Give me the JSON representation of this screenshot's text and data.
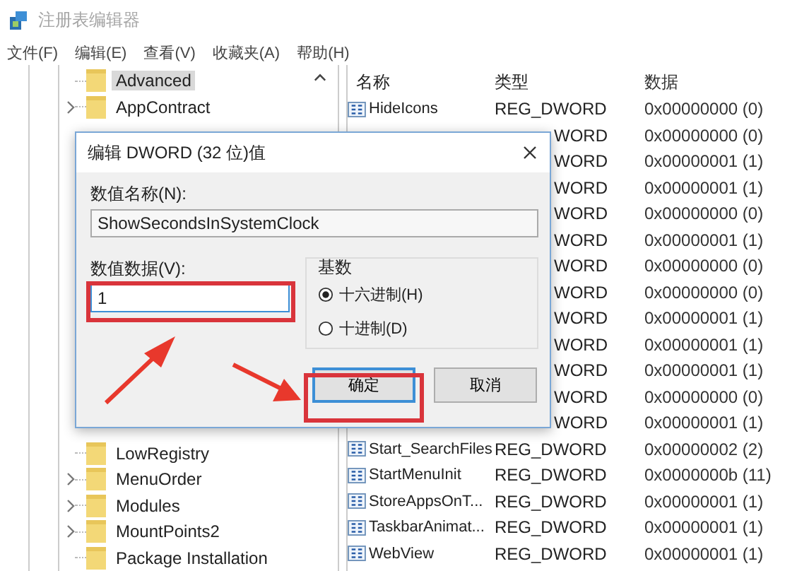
{
  "window": {
    "title": "注册表编辑器"
  },
  "menu": [
    "文件(F)",
    "编辑(E)",
    "查看(V)",
    "收藏夹(A)",
    "帮助(H)"
  ],
  "tree": {
    "top": [
      {
        "label": "Advanced",
        "selected": true,
        "expandable": false
      },
      {
        "label": "AppContract",
        "selected": false,
        "expandable": true
      }
    ],
    "bottom": [
      {
        "label": "LowRegistry",
        "selected": false,
        "expandable": false
      },
      {
        "label": "MenuOrder",
        "selected": false,
        "expandable": true
      },
      {
        "label": "Modules",
        "selected": false,
        "expandable": true
      },
      {
        "label": "MountPoints2",
        "selected": false,
        "expandable": true
      },
      {
        "label": "Package Installation",
        "selected": false,
        "expandable": false
      }
    ]
  },
  "values": {
    "columns": [
      "名称",
      "类型",
      "数据"
    ],
    "rows": [
      {
        "name": "HideIcons",
        "type": "REG_DWORD",
        "data": "0x00000000 (0)"
      },
      {
        "type": "WORD",
        "data": "0x00000000 (0)"
      },
      {
        "type": "WORD",
        "data": "0x00000001 (1)"
      },
      {
        "type": "WORD",
        "data": "0x00000001 (1)"
      },
      {
        "type": "WORD",
        "data": "0x00000000 (0)"
      },
      {
        "type": "WORD",
        "data": "0x00000001 (1)"
      },
      {
        "type": "WORD",
        "data": "0x00000000 (0)"
      },
      {
        "type": "WORD",
        "data": "0x00000000 (0)"
      },
      {
        "type": "WORD",
        "data": "0x00000001 (1)"
      },
      {
        "type": "WORD",
        "data": "0x00000001 (1)"
      },
      {
        "type": "WORD",
        "data": "0x00000001 (1)"
      },
      {
        "type": "WORD",
        "data": "0x00000000 (0)"
      },
      {
        "type": "WORD",
        "data": "0x00000001 (1)"
      },
      {
        "name": "Start_SearchFiles",
        "type": "REG_DWORD",
        "data": "0x00000002 (2)"
      },
      {
        "name": "StartMenuInit",
        "type": "REG_DWORD",
        "data": "0x0000000b (11)"
      },
      {
        "name": "StoreAppsOnT...",
        "type": "REG_DWORD",
        "data": "0x00000001 (1)"
      },
      {
        "name": "TaskbarAnimat...",
        "type": "REG_DWORD",
        "data": "0x00000001 (1)"
      },
      {
        "name": "WebView",
        "type": "REG_DWORD",
        "data": "0x00000001 (1)"
      }
    ]
  },
  "dialog": {
    "title": "编辑 DWORD (32 位)值",
    "name_label": "数值名称(N):",
    "name_value": "ShowSecondsInSystemClock",
    "data_label": "数值数据(V):",
    "data_value": "1",
    "base_label": "基数",
    "radios": [
      {
        "label": "十六进制(H)",
        "selected": true
      },
      {
        "label": "十进制(D)",
        "selected": false
      }
    ],
    "buttons": [
      {
        "label": "确定",
        "default": true
      },
      {
        "label": "取消",
        "default": false
      }
    ]
  }
}
